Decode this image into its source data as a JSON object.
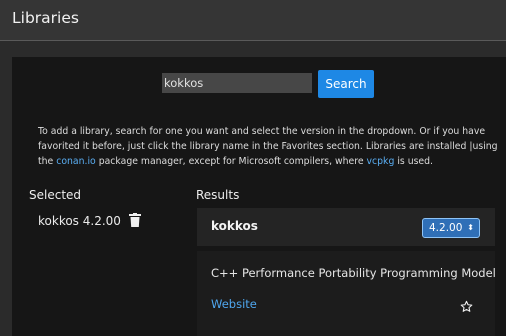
{
  "header": {
    "title": "Libraries"
  },
  "search": {
    "value": "kokkos",
    "button_label": "Search"
  },
  "description": {
    "part1": "To add a library, search for one you want and select the version in the dropdown. Or if you have favorited it before, just click the library name in the Favorites section. Libraries are installed |using the ",
    "link1": "conan.io",
    "part2": " package manager, except for Microsoft compilers, where ",
    "link2": "vcpkg",
    "part3": " is used."
  },
  "selected": {
    "heading": "Selected",
    "items": [
      {
        "label": "kokkos 4.2.00",
        "icon": "trash-icon"
      }
    ]
  },
  "results": {
    "heading": "Results",
    "items": [
      {
        "name": "kokkos",
        "version": "4.2.00",
        "description": "C++ Performance Portability Programming Model",
        "website_label": "Website",
        "favorite_icon": "star-outline-icon"
      }
    ]
  },
  "colors": {
    "background": "#2b2b2b",
    "panel": "#161616",
    "accent": "#1e88e5",
    "link": "#5aaef3"
  }
}
